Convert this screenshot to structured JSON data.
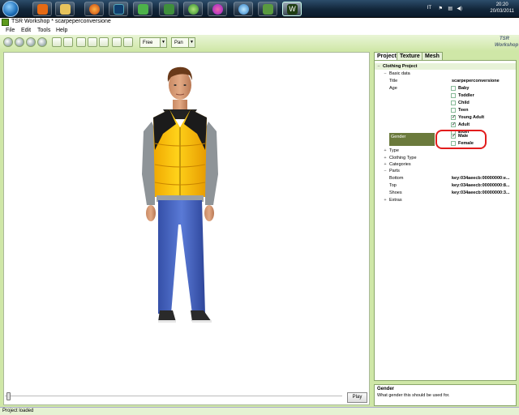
{
  "taskbar": {
    "language": "IT",
    "time": "20:20",
    "date": "20/03/2011"
  },
  "window": {
    "title": "TSR Workshop * scarpeperconversione"
  },
  "menu": [
    "File",
    "Edit",
    "Tools",
    "Help"
  ],
  "toolbar": {
    "camera_mode": "Free",
    "nav_mode": "Pan",
    "brand": "TSR Workshop"
  },
  "viewport": {
    "play_label": "Play"
  },
  "tabs": [
    "Project",
    "Texture",
    "Mesh"
  ],
  "tree": {
    "root": "Clothing Project",
    "basic_data": "Basic data",
    "title_label": "Title",
    "title_value": "scarpeperconversione",
    "age_label": "Age",
    "ages": [
      {
        "label": "Baby",
        "checked": false
      },
      {
        "label": "Toddler",
        "checked": false
      },
      {
        "label": "Child",
        "checked": false
      },
      {
        "label": "Teen",
        "checked": false
      },
      {
        "label": "Young Adult",
        "checked": true
      },
      {
        "label": "Adult",
        "checked": true
      },
      {
        "label": "Elder",
        "checked": false
      }
    ],
    "gender_label": "Gender",
    "genders": [
      {
        "label": "Male",
        "checked": true
      },
      {
        "label": "Female",
        "checked": false
      }
    ],
    "type": "Type",
    "clothing_type": "Clothing Type",
    "categories": "Categories",
    "parts": "Parts",
    "part_rows": [
      {
        "label": "Bottom",
        "value": "key:034aeecb:00000000:e..."
      },
      {
        "label": "Top",
        "value": "key:034aeecb:00000000:8..."
      },
      {
        "label": "Shoes",
        "value": "key:034aeecb:00000000:3..."
      }
    ],
    "extras": "Extras"
  },
  "description": {
    "title": "Gender",
    "text": "What gender this should be used for."
  },
  "status": "Project loaded"
}
